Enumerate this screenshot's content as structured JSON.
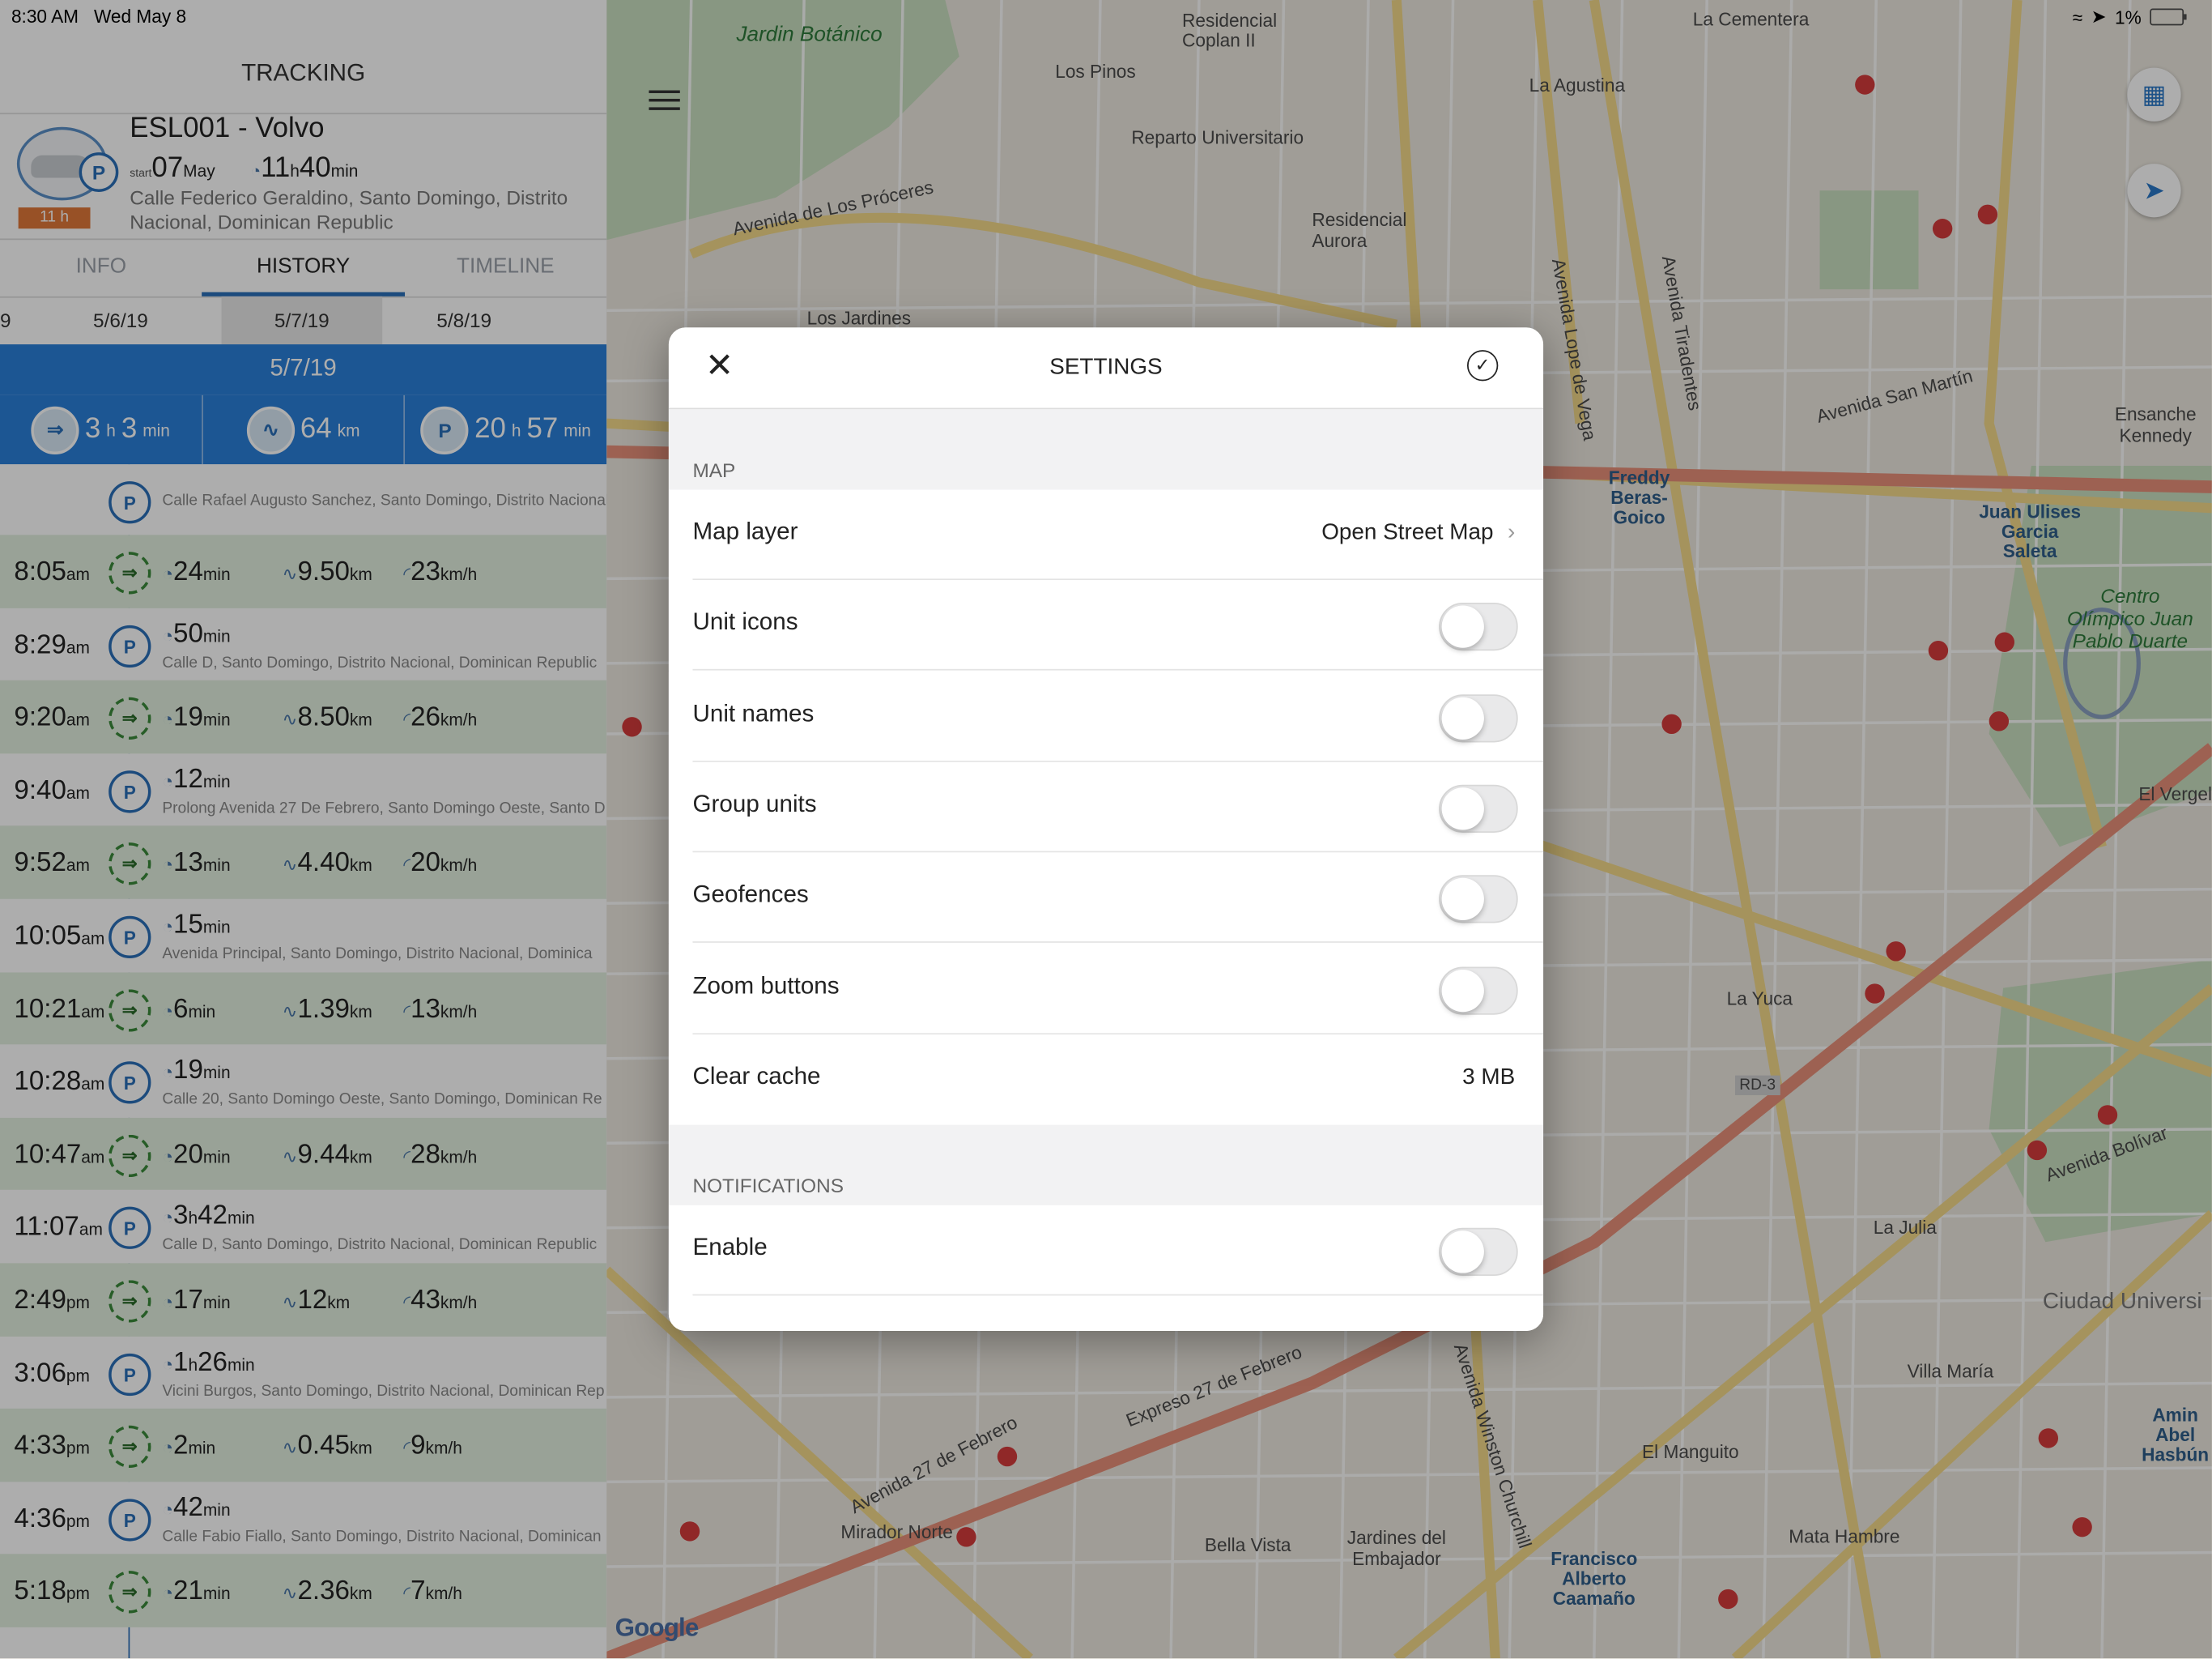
{
  "status_bar": {
    "time": "8:30 AM",
    "date": "Wed May 8",
    "battery": "1%"
  },
  "panel": {
    "title": "TRACKING",
    "unit": {
      "name": "ESL001 - Volvo",
      "start_label": "start",
      "start_day": "07",
      "start_month": "May",
      "duration_h": "11",
      "duration_m": "40",
      "h_unit": "h",
      "min_unit": "min",
      "badge": "11 h",
      "address": "Calle Federico Geraldino, Santo Domingo, Distrito Nacional, Dominican Republic"
    },
    "tabs": [
      "INFO",
      "HISTORY",
      "TIMELINE"
    ],
    "dates": [
      "9",
      "5/6/19",
      "5/7/19",
      "5/8/19"
    ],
    "selected_date": "5/7/19",
    "summary": {
      "trip_h": "3",
      "trip_m": "3",
      "distance": "64",
      "distance_unit": "km",
      "park_h": "20",
      "park_m": "57"
    },
    "first_address": "Calle Rafael Augusto Sanchez, Santo Domingo, Distrito Nacional",
    "rows": [
      {
        "type": "trip",
        "time": "8:05",
        "ampm": "am",
        "dur": "24",
        "dur_unit": "min",
        "dist": "9.50",
        "speed": "23"
      },
      {
        "type": "stop",
        "time": "8:29",
        "ampm": "am",
        "dur": "50",
        "dur_unit": "min",
        "addr": "Calle D, Santo Domingo, Distrito Nacional, Dominican Republic"
      },
      {
        "type": "trip",
        "time": "9:20",
        "ampm": "am",
        "dur": "19",
        "dur_unit": "min",
        "dist": "8.50",
        "speed": "26"
      },
      {
        "type": "stop",
        "time": "9:40",
        "ampm": "am",
        "dur": "12",
        "dur_unit": "min",
        "addr": "Prolong Avenida 27 De Febrero, Santo Domingo Oeste, Santo D"
      },
      {
        "type": "trip",
        "time": "9:52",
        "ampm": "am",
        "dur": "13",
        "dur_unit": "min",
        "dist": "4.40",
        "speed": "20"
      },
      {
        "type": "stop",
        "time": "10:05",
        "ampm": "am",
        "dur": "15",
        "dur_unit": "min",
        "addr": "Avenida Principal, Santo Domingo, Distrito Nacional, Dominica"
      },
      {
        "type": "trip",
        "time": "10:21",
        "ampm": "am",
        "dur": "6",
        "dur_unit": "min",
        "dist": "1.39",
        "speed": "13"
      },
      {
        "type": "stop",
        "time": "10:28",
        "ampm": "am",
        "dur": "19",
        "dur_unit": "min",
        "addr": "Calle 20, Santo Domingo Oeste, Santo Domingo, Dominican Re"
      },
      {
        "type": "trip",
        "time": "10:47",
        "ampm": "am",
        "dur": "20",
        "dur_unit": "min",
        "dist": "9.44",
        "speed": "28"
      },
      {
        "type": "stop",
        "time": "11:07",
        "ampm": "am",
        "dur_h": "3",
        "dur": "42",
        "dur_unit": "min",
        "addr": "Calle D, Santo Domingo, Distrito Nacional, Dominican Republic"
      },
      {
        "type": "trip",
        "time": "2:49",
        "ampm": "pm",
        "dur": "17",
        "dur_unit": "min",
        "dist": "12",
        "speed": "43"
      },
      {
        "type": "stop",
        "time": "3:06",
        "ampm": "pm",
        "dur_h": "1",
        "dur": "26",
        "dur_unit": "min",
        "addr": "Vicini Burgos, Santo Domingo, Distrito Nacional, Dominican Rep"
      },
      {
        "type": "trip",
        "time": "4:33",
        "ampm": "pm",
        "dur": "2",
        "dur_unit": "min",
        "dist": "0.45",
        "speed": "9"
      },
      {
        "type": "stop",
        "time": "4:36",
        "ampm": "pm",
        "dur": "42",
        "dur_unit": "min",
        "addr": "Calle Fabio Fiallo, Santo Domingo, Distrito Nacional, Dominican"
      },
      {
        "type": "trip",
        "time": "5:18",
        "ampm": "pm",
        "dur": "21",
        "dur_unit": "min",
        "dist": "2.36",
        "speed": "7"
      }
    ],
    "units": {
      "km": "km",
      "kmh": "km/h",
      "h": "h"
    }
  },
  "map": {
    "labels": {
      "jardin": "Jardin Botánico",
      "cementera": "La Cementera",
      "residencial_coplan": "Residencial Coplan II",
      "los_pinos": "Los Pinos",
      "agustina": "La Agustina",
      "reparto": "Reparto Universitario",
      "proceres": "Avenida de Los Próceres",
      "residencial_aurora": "Residencial Aurora",
      "los_jardines": "Los Jardines",
      "freddy": "Freddy Beras-Goico",
      "juan_ulises": "Juan Ulises Garcia Saleta",
      "centro_olimpico": "Centro Olímpico Juan Pablo Duarte",
      "ensanche_kennedy": "Ensanche Kennedy",
      "el_vergel": "El Vergel",
      "la_yuca": "La Yuca",
      "la_julia": "La Julia",
      "villa_maria": "Villa María",
      "ciudad_univ": "Ciudad Universi",
      "amin": "Amin Abel Hasbún",
      "el_manguito": "El Manguito",
      "mirador_norte": "Mirador Norte",
      "bella_vista": "Bella Vista",
      "jardines_embajador": "Jardines del Embajador",
      "mata_hambre": "Mata Hambre",
      "francisco": "Francisco Alberto Caamaño",
      "expreso": "Expreso 27 de Febrero",
      "ave_27": "Avenida 27 de Febrero",
      "bolivar": "Avenida Bolívar",
      "tiradentes": "Avenida Tiradentes",
      "lope_vega": "Avenida Lope de Vega",
      "san_martin": "Avenida San Martín",
      "churchill": "Avenida Winston Churchill",
      "rd3": "RD-3",
      "google": "Google"
    }
  },
  "modal": {
    "title": "SETTINGS",
    "sections": [
      {
        "title": "MAP",
        "rows": [
          {
            "label": "Map layer",
            "value": "Open Street Map",
            "type": "link"
          },
          {
            "label": "Unit icons",
            "type": "toggle",
            "on": false
          },
          {
            "label": "Unit names",
            "type": "toggle",
            "on": false
          },
          {
            "label": "Group units",
            "type": "toggle",
            "on": false
          },
          {
            "label": "Geofences",
            "type": "toggle",
            "on": false
          },
          {
            "label": "Zoom buttons",
            "type": "toggle",
            "on": false
          },
          {
            "label": "Clear cache",
            "value": "3 MB",
            "type": "value"
          }
        ]
      },
      {
        "title": "NOTIFICATIONS",
        "rows": [
          {
            "label": "Enable",
            "type": "toggle",
            "on": false
          }
        ]
      }
    ]
  }
}
